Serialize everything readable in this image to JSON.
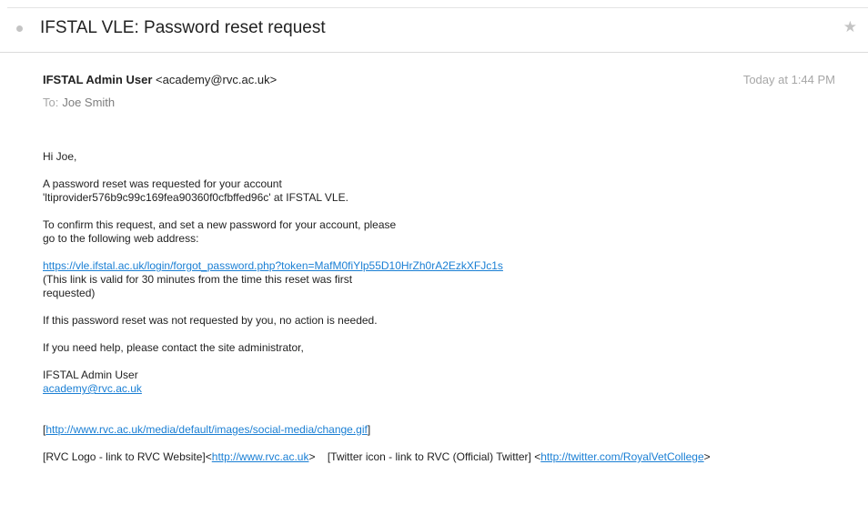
{
  "email": {
    "subject": "IFSTAL VLE: Password reset request",
    "sender_name": "IFSTAL Admin User",
    "sender_email": "<academy@rvc.ac.uk>",
    "timestamp": "Today at 1:44 PM",
    "to_label": "To:",
    "recipient": "Joe Smith"
  },
  "body": {
    "greeting": "Hi Joe,",
    "p1_line1": "A password reset was requested for your account",
    "p1_line2": "'ltiprovider576b9c99c169fea90360f0cfbffed96c' at IFSTAL VLE.",
    "p2_line1": "To confirm this request, and set a new password for your account, please",
    "p2_line2": "go to the following web address:",
    "reset_link": "https://vle.ifstal.ac.uk/login/forgot_password.php?token=MafM0fiYlp55D10HrZh0rA2EzkXFJc1s",
    "valid_line1": "(This link is valid for 30 minutes from the time this reset was first",
    "valid_line2": "requested)",
    "no_action": "If this password reset was not requested by you, no action is needed.",
    "help": "If you need help, please contact the site administrator,",
    "signature_name": "IFSTAL Admin User",
    "signature_email": "academy@rvc.ac.uk",
    "image_open": "[",
    "image_link": "http://www.rvc.ac.uk/media/default/images/social-media/change.gif",
    "image_close": "]",
    "rvc_logo_text": "[RVC Logo - link to RVC Website]<",
    "rvc_link": "http://www.rvc.ac.uk",
    "rvc_close": ">",
    "twitter_text": "[Twitter icon - link to RVC (Official) Twitter] <",
    "twitter_link": "http://twitter.com/RoyalVetCollege",
    "twitter_close": ">"
  },
  "colors": {
    "link": "#1a7fd4",
    "muted": "#a7a7a7"
  }
}
